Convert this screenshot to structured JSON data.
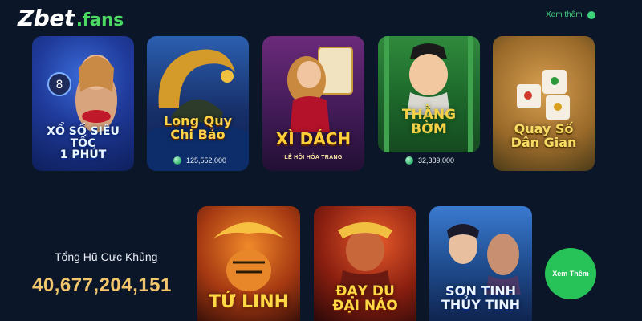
{
  "logo": {
    "brand": "Zbet",
    "suffix": ".fans"
  },
  "see_more_top": "Xem thêm",
  "games_top": [
    {
      "title": "XỔ SỐ SIÊU TỐC\n1 PHÚT",
      "subtitle": "",
      "count": ""
    },
    {
      "title": "Long Quy\nChi Bảo",
      "subtitle": "",
      "count": "125,552,000"
    },
    {
      "title": "XÌ DÁCH",
      "subtitle": "LỄ HỘI HÓA TRANG",
      "count": ""
    },
    {
      "title": "THẰNG\nBỜM",
      "subtitle": "",
      "count": "32,389,000"
    },
    {
      "title": "Quay Số\nDân Gian",
      "subtitle": "",
      "count": ""
    }
  ],
  "games_bottom": [
    {
      "title": "TỨ LINH"
    },
    {
      "title": "ĐẠY DU\nĐẠI NÁO"
    },
    {
      "title": "SƠN TINH\nTHỦY TINH"
    }
  ],
  "jackpot": {
    "label": "Tổng Hũ Cực Khủng",
    "value": "40,677,204,151"
  },
  "see_more_button": "Xem Thêm",
  "colors": {
    "background": "#0b1628",
    "accent": "#27c258",
    "jackpot": "#f2c66d"
  }
}
